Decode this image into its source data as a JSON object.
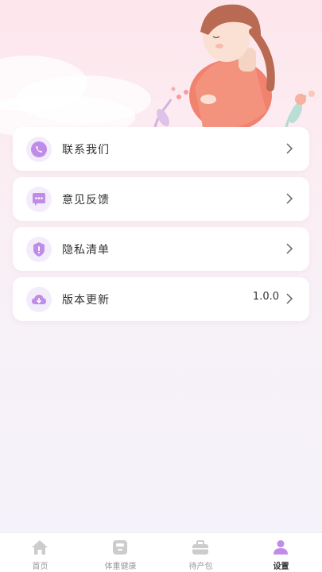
{
  "menu": {
    "items": [
      {
        "label": "联系我们",
        "icon": "phone-icon",
        "value": ""
      },
      {
        "label": "意见反馈",
        "icon": "message-icon",
        "value": ""
      },
      {
        "label": "隐私清单",
        "icon": "shield-icon",
        "value": ""
      },
      {
        "label": "版本更新",
        "icon": "cloud-download-icon",
        "value": "1.0.0"
      }
    ]
  },
  "tabbar": {
    "tabs": [
      {
        "label": "首页",
        "icon": "home-icon",
        "active": false
      },
      {
        "label": "体重健康",
        "icon": "scale-icon",
        "active": false
      },
      {
        "label": "待产包",
        "icon": "bag-icon",
        "active": false
      },
      {
        "label": "设置",
        "icon": "user-icon",
        "active": true
      }
    ]
  },
  "colors": {
    "accent": "#c08ce8",
    "icon_bg": "#f3ecfb",
    "tab_inactive": "#cccccc",
    "text": "#333333"
  }
}
